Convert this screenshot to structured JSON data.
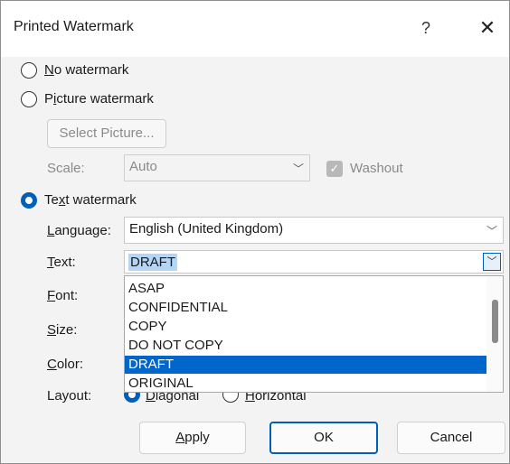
{
  "window": {
    "title": "Printed Watermark",
    "help_glyph": "?",
    "close_glyph": "✕"
  },
  "options": {
    "no_watermark_pre": "",
    "no_watermark_u": "N",
    "no_watermark_post": "o watermark",
    "picture_watermark_pre": "P",
    "picture_watermark_u": "i",
    "picture_watermark_post": "cture watermark",
    "text_watermark_pre": "Te",
    "text_watermark_u": "x",
    "text_watermark_post": "t watermark",
    "selected": "text"
  },
  "picture": {
    "select_button": "Select Picture...",
    "scale_label": "Scale:",
    "scale_value": "Auto",
    "washout_label": "Washout",
    "washout_checked": true
  },
  "text_settings": {
    "language_label_u": "L",
    "language_label_rest": "anguage:",
    "language_value": "English (United Kingdom)",
    "text_label_u": "T",
    "text_label_rest": "ext:",
    "text_value": "DRAFT",
    "font_label_u": "F",
    "font_label_rest": "ont:",
    "size_label_u": "S",
    "size_label_rest": "ize:",
    "color_label_u": "C",
    "color_label_rest": "olor:",
    "layout_label": "Layout:",
    "layout_diagonal_u": "D",
    "layout_diagonal_rest": "iagonal",
    "layout_horizontal_u": "H",
    "layout_horizontal_rest": "orizontal",
    "layout_selected": "diagonal"
  },
  "dropdown": {
    "items": [
      "ASAP",
      "CONFIDENTIAL",
      "COPY",
      "DO NOT COPY",
      "DRAFT",
      "ORIGINAL"
    ],
    "selected": "DRAFT"
  },
  "buttons": {
    "apply_u": "A",
    "apply_rest": "pply",
    "ok": "OK",
    "cancel": "Cancel"
  },
  "colors": {
    "accent": "#005fb8",
    "selection": "#0066cc"
  }
}
